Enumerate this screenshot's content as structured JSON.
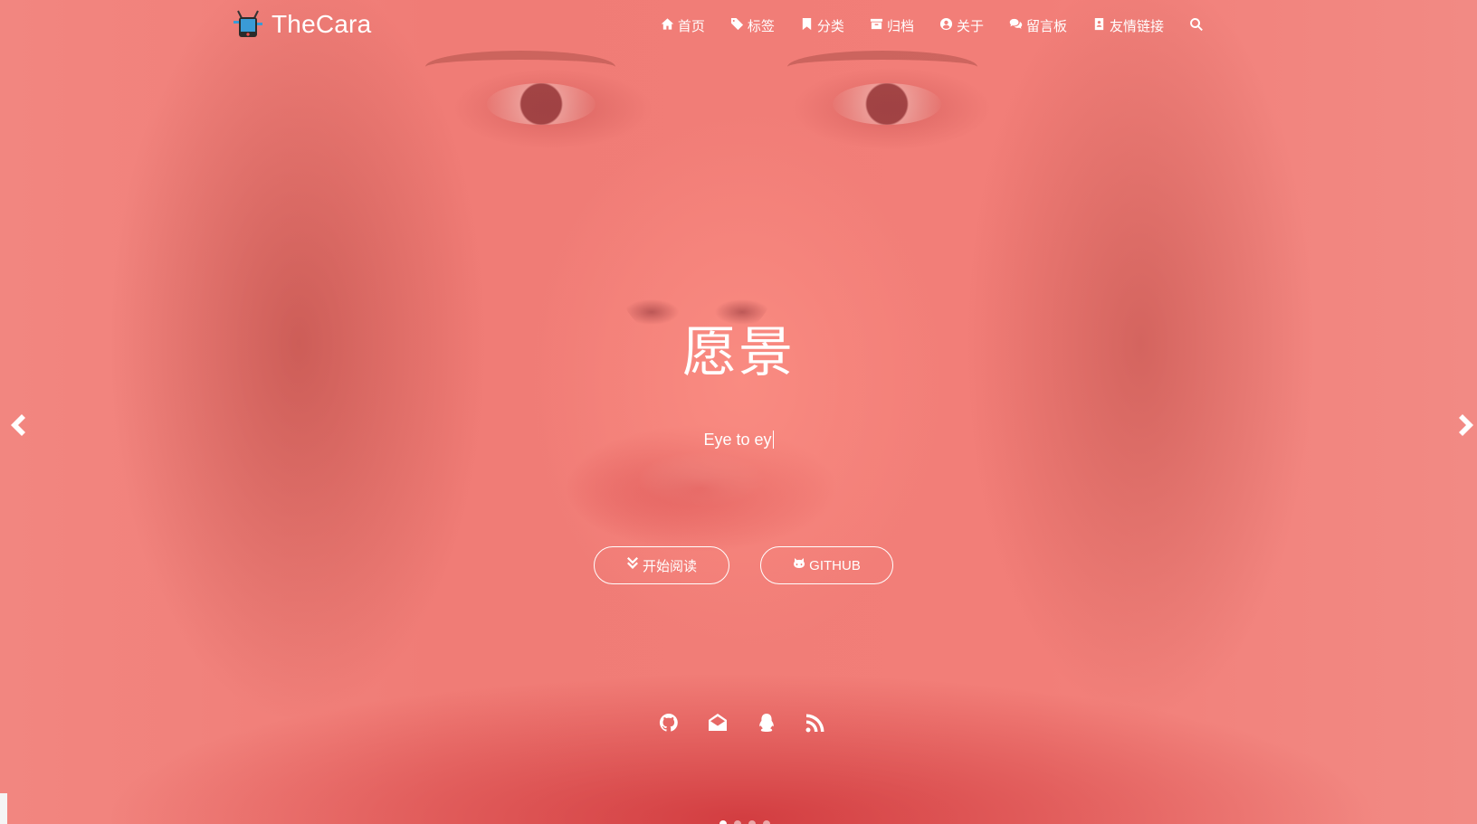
{
  "brand": {
    "title": "TheCara",
    "logo_icon": "tv-robot-icon"
  },
  "nav": {
    "items": [
      {
        "label": "首页",
        "icon": "home-icon"
      },
      {
        "label": "标签",
        "icon": "tags-icon"
      },
      {
        "label": "分类",
        "icon": "bookmark-icon"
      },
      {
        "label": "归档",
        "icon": "archive-icon"
      },
      {
        "label": "关于",
        "icon": "user-circle-icon"
      },
      {
        "label": "留言板",
        "icon": "comments-icon"
      },
      {
        "label": "友情链接",
        "icon": "address-book-icon"
      }
    ],
    "search_icon": "search-icon"
  },
  "hero": {
    "title": "愿景",
    "subtitle": "Eye to ey",
    "buttons": {
      "read_label": "开始阅读",
      "read_icon": "double-chevron-down-icon",
      "github_label": "GITHUB",
      "github_icon": "github-cat-icon"
    },
    "social": [
      "github-icon",
      "mail-open-icon",
      "qq-icon",
      "rss-icon"
    ],
    "carousel": {
      "slide_count": 4,
      "active_index": 0
    }
  },
  "colors": {
    "overlay": "#f07a74",
    "text": "#ffffff"
  }
}
